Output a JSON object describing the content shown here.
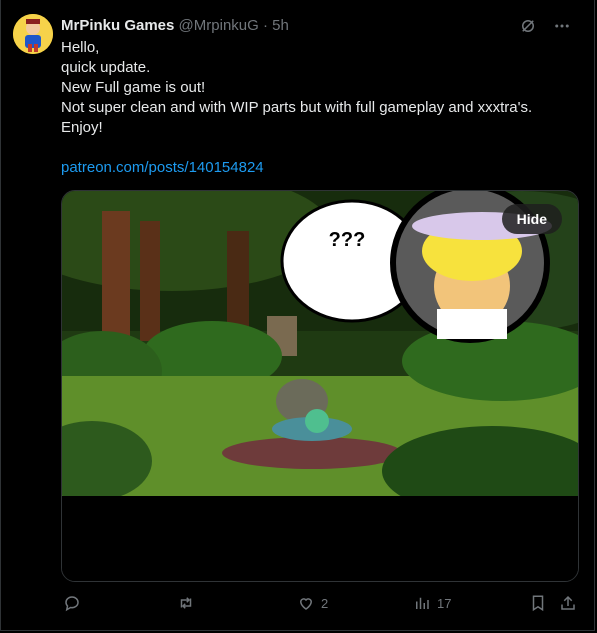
{
  "author": {
    "name": "MrPinku Games",
    "handle": "@MrpinkuG",
    "separator": "·",
    "time": "5h"
  },
  "post": {
    "lines": [
      "Hello,",
      "quick update.",
      "New Full game is out!",
      "Not super clean and with WIP parts but with full gameplay and xxxtra's.",
      "Enjoy!"
    ],
    "link": "patreon.com/posts/140154824"
  },
  "media": {
    "speech_text": "???",
    "hide_label": "Hide"
  },
  "actions": {
    "likes": "2",
    "views": "17"
  },
  "icons": {
    "grok": "grok-icon",
    "more": "more-icon",
    "reply": "reply-icon",
    "repost": "repost-icon",
    "like": "heart-icon",
    "views": "views-icon",
    "bookmark": "bookmark-icon",
    "share": "share-icon"
  },
  "colors": {
    "link": "#1d9bf0",
    "muted": "#71767b",
    "text": "#e7e9ea",
    "background": "#000000"
  }
}
